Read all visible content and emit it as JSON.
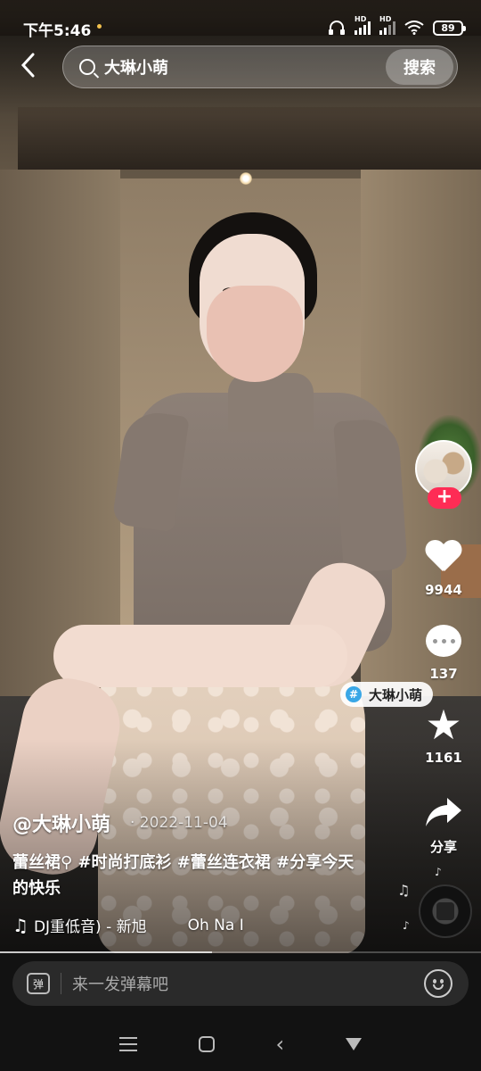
{
  "status_bar": {
    "time": "下午5:46",
    "battery": "89",
    "hd1": "HD",
    "hd2": "HD"
  },
  "search": {
    "query": "大琳小萌",
    "button_label": "搜索"
  },
  "actions": {
    "follow_label": "+",
    "like_count": "9944",
    "comment_count": "137",
    "favorite_count": "1161",
    "share_label": "分享"
  },
  "topic_tag": {
    "hash": "#",
    "label": "大琳小萌"
  },
  "caption": {
    "author": "@大琳小萌",
    "date": "· 2022-11-04",
    "description": "蕾丝裙⚲ #时尚打底衫 #蕾丝连衣裙 #分享今天的快乐",
    "music_title": "DJ重低音) - 新旭",
    "music_extra": "Oh Na I"
  },
  "danmaku": {
    "icon_label": "弹",
    "placeholder": "来一发弹幕吧"
  },
  "icons": {
    "back": "back-arrow-icon",
    "search": "search-icon",
    "like": "heart-icon",
    "comment": "comment-icon",
    "favorite": "star-icon",
    "share": "share-arrow-icon",
    "music": "music-note-icon",
    "emoji": "emoji-icon"
  },
  "colors": {
    "follow": "#fe2c55",
    "topic_hash": "#3aa7e6",
    "status_dot": "#f2c14e"
  },
  "playback_progress": 0.44
}
